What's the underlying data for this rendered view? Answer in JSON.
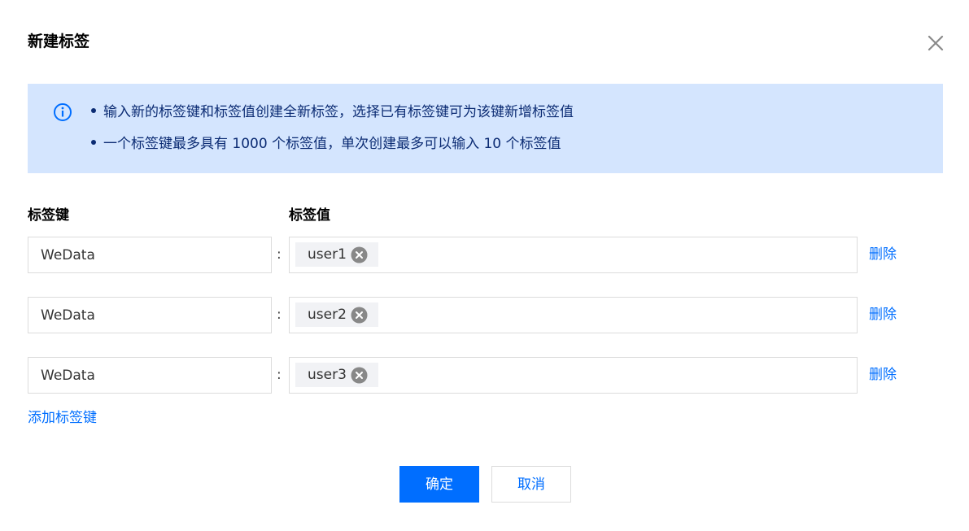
{
  "dialog": {
    "title": "新建标签"
  },
  "notice": {
    "lines": [
      "输入新的标签键和标签值创建全新标签，选择已有标签键可为该键新增标签值",
      "一个标签键最多具有 1000 个标签值，单次创建最多可以输入 10 个标签值"
    ],
    "icon": "info-circle-icon"
  },
  "columns": {
    "key_header": "标签键",
    "value_header": "标签值"
  },
  "rows": [
    {
      "key": "WeData",
      "separator": ":",
      "tags": [
        "user1"
      ],
      "delete_label": "删除"
    },
    {
      "key": "WeData",
      "separator": ":",
      "tags": [
        "user2"
      ],
      "delete_label": "删除"
    },
    {
      "key": "WeData",
      "separator": ":",
      "tags": [
        "user3"
      ],
      "delete_label": "删除"
    }
  ],
  "add_key_label": "添加标签键",
  "buttons": {
    "confirm": "确定",
    "cancel": "取消"
  },
  "colors": {
    "primary": "#006eff",
    "notice_bg": "#d4e5fe",
    "notice_text": "#0b2b73"
  }
}
